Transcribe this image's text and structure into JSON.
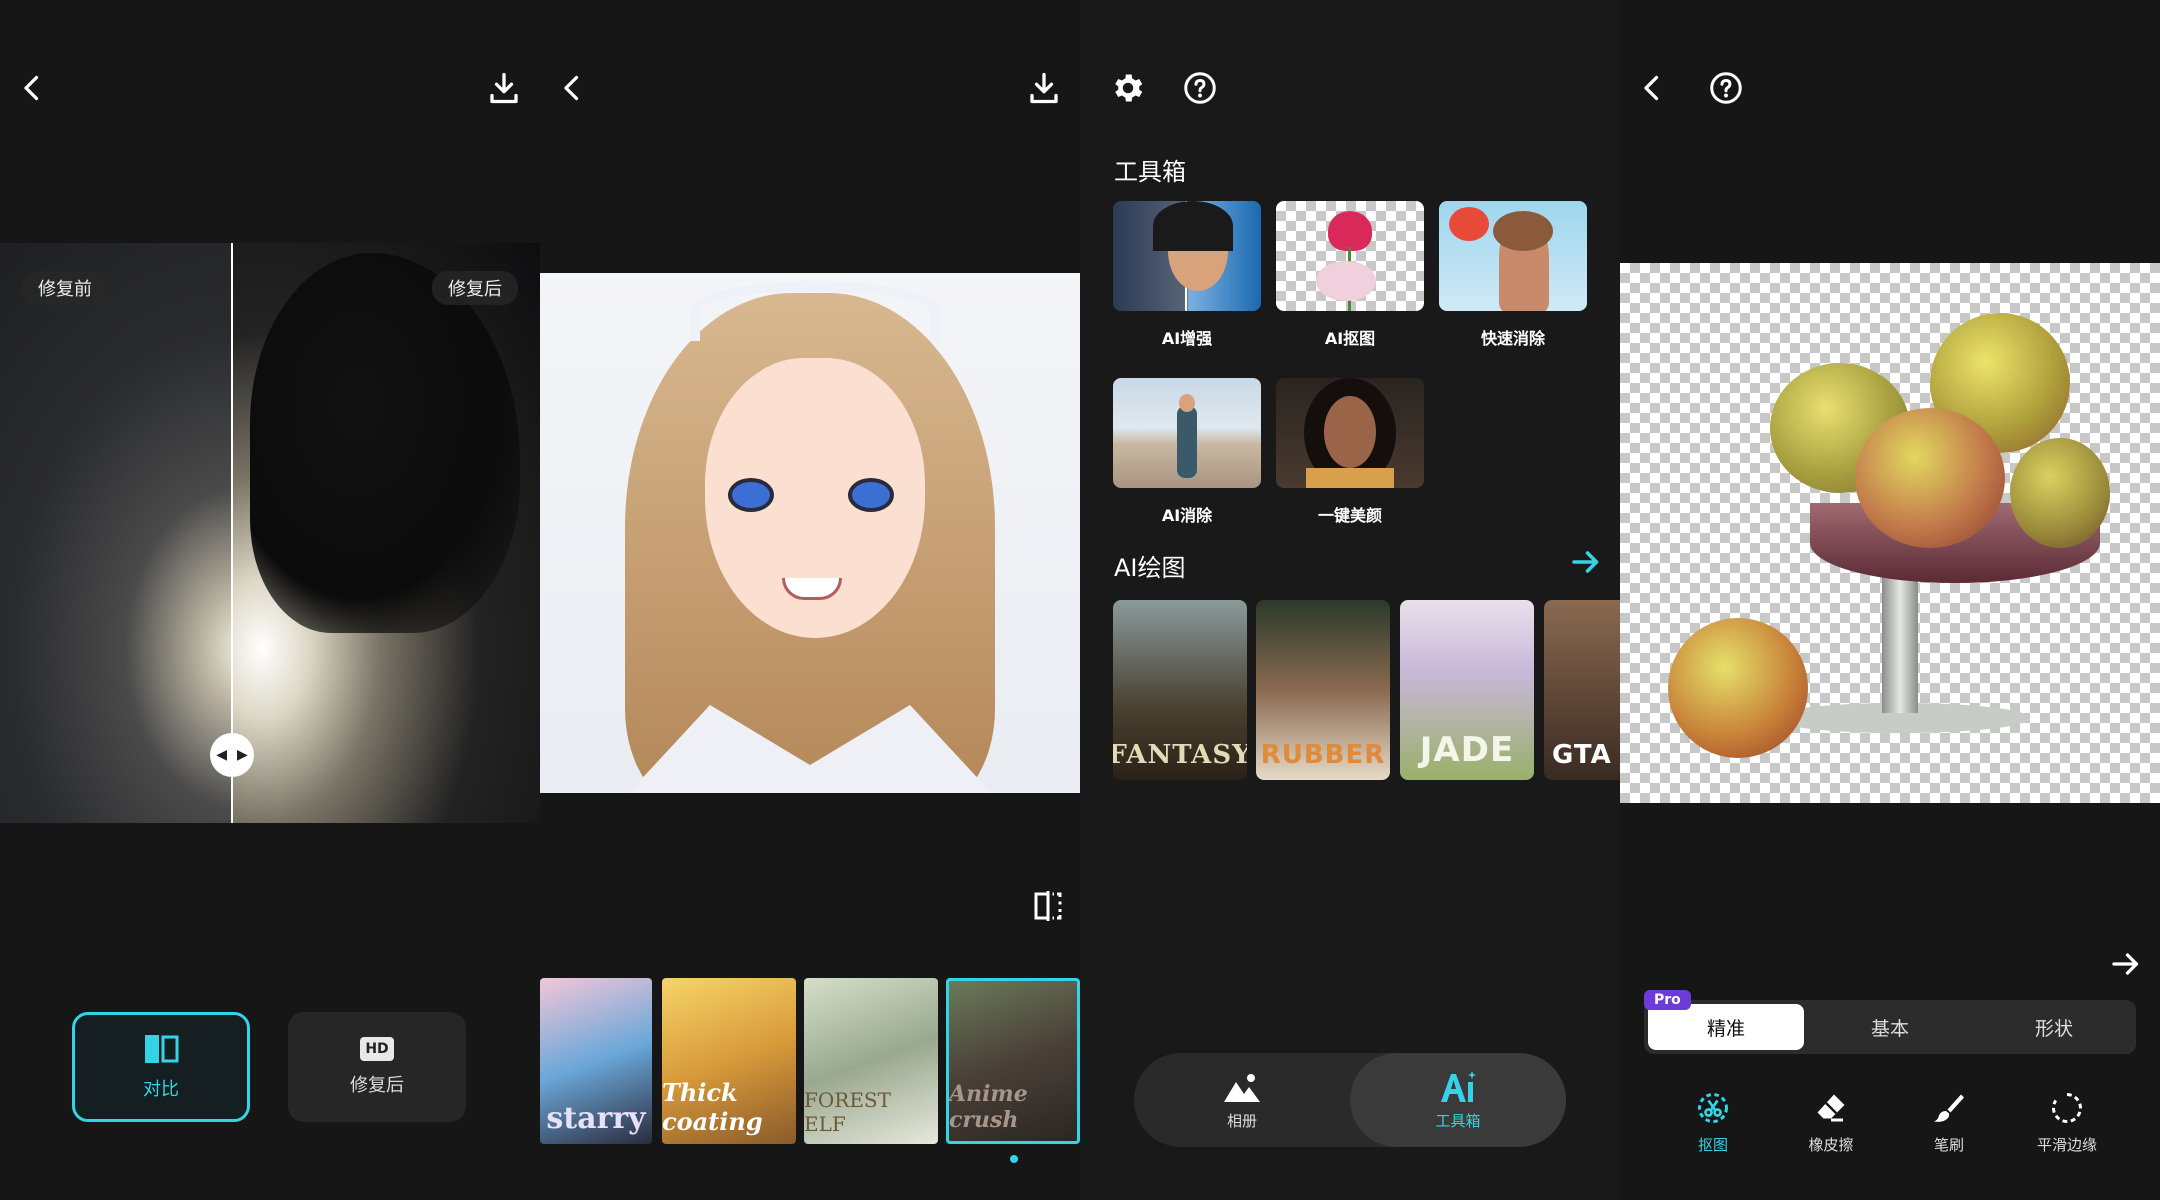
{
  "panel1": {
    "before_label": "修复前",
    "after_label": "修复后",
    "btn_compare": "对比",
    "btn_after": "修复后",
    "hd_badge": "HD"
  },
  "panel2": {
    "styles": [
      {
        "name": "starry",
        "color": "#e8e0f8"
      },
      {
        "name": "Thick coating",
        "color": "#ffffff"
      },
      {
        "name": "FOREST ELF",
        "color": "#f0f0e0"
      },
      {
        "name": "Anime crush",
        "color": "#9a8a80"
      }
    ]
  },
  "panel3": {
    "toolbox_title": "工具箱",
    "tools": [
      {
        "label": "AI增强"
      },
      {
        "label": "AI抠图"
      },
      {
        "label": "快速消除"
      },
      {
        "label": "AI消除"
      },
      {
        "label": "一键美颜"
      }
    ],
    "ai_draw_title": "AI绘图",
    "ai_cards": [
      {
        "text": "FANTASY"
      },
      {
        "text": "RUBBER"
      },
      {
        "text": "JADE"
      },
      {
        "text": "GTA S"
      }
    ],
    "nav": {
      "album": "相册",
      "toolbox": "工具箱"
    }
  },
  "panel4": {
    "pro_badge": "Pro",
    "seg": [
      "精准",
      "基本",
      "形状"
    ],
    "tools": [
      "抠图",
      "橡皮擦",
      "笔刷",
      "平滑边缘"
    ]
  },
  "colors": {
    "accent": "#33d4e5",
    "background": "#161616",
    "pro": "#6c3bd8"
  }
}
